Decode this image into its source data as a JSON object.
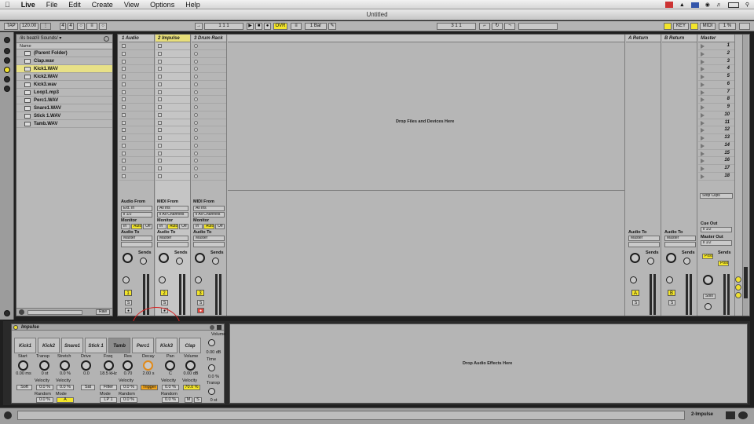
{
  "menubar": {
    "app": "Live",
    "items": [
      "File",
      "Edit",
      "Create",
      "View",
      "Options",
      "Help"
    ]
  },
  "window": {
    "title": "Untitled"
  },
  "transport": {
    "tap": "TAP",
    "tempo": "120.00",
    "signature_num": "4",
    "signature_den": "4",
    "arrangement_position": "1    1    1",
    "ovr": "OVR",
    "quantize": "1 Bar",
    "loop_start": "3    1    1",
    "key": "KEY",
    "midi": "MIDI",
    "cpu": "1 %"
  },
  "browser": {
    "path": "/ils beat/il Sounds/",
    "column_header": "Name",
    "items": [
      {
        "label": "(Parent Folder)",
        "selected": false
      },
      {
        "label": "Clap.wav",
        "selected": false
      },
      {
        "label": "Kick1.WAV",
        "selected": true
      },
      {
        "label": "Kick2.WAV",
        "selected": false
      },
      {
        "label": "Kick3.wav",
        "selected": false
      },
      {
        "label": "Loop1.mp3",
        "selected": false
      },
      {
        "label": "Perc1.WAV",
        "selected": false
      },
      {
        "label": "Snare1.WAV",
        "selected": false
      },
      {
        "label": "Stick 1.WAV",
        "selected": false
      },
      {
        "label": "Tamb.WAV",
        "selected": false
      }
    ],
    "raw_label": "Raw"
  },
  "session": {
    "tracks": [
      {
        "name": "1 Audio",
        "number": "1",
        "selected": false
      },
      {
        "name": "2 Impulse",
        "number": "2",
        "selected": true
      },
      {
        "name": "3 Drum Rack",
        "number": "3",
        "selected": false
      }
    ],
    "returns": [
      {
        "name": "A Return",
        "letter": "A"
      },
      {
        "name": "B Return",
        "letter": "B"
      }
    ],
    "master": {
      "name": "Master",
      "scenes": [
        "1",
        "2",
        "3",
        "4",
        "5",
        "6",
        "7",
        "8",
        "9",
        "10",
        "11",
        "12",
        "13",
        "14",
        "15",
        "16",
        "17",
        "18"
      ],
      "stop_clips": "Stop Clips",
      "cue_out": "Cue Out",
      "cue_out_value": "ii 1/2",
      "master_out": "Master Out",
      "master_out_value": "ii 1/2",
      "solo": "Solo",
      "post": "Post"
    },
    "drop_message": "Drop Files and Devices Here",
    "io": {
      "audio_from": "Audio From",
      "midi_from": "MIDI From",
      "ext_in": "Ext. In",
      "all_ins": "All Ins",
      "half": "ii 1/2",
      "all_channels": "ii All Channels",
      "monitor": "Monitor",
      "in": "In",
      "auto": "Auto",
      "off": "Off",
      "audio_to": "Audio To",
      "master": "Master",
      "sends": "Sends",
      "a": "A",
      "b": "B",
      "s": "S"
    }
  },
  "impulse": {
    "title": "Impulse",
    "pads": [
      "Kick1",
      "Kick2",
      "Snare1",
      "Stick 1",
      "Tamb",
      "Perc1",
      "Kick3",
      "Clap"
    ],
    "selected_pad": "Tamb",
    "volume_label": "Volume",
    "volume_value": "0.00 dB",
    "time_label": "Time",
    "time_value": "0.0 %",
    "transp_label": "Transp",
    "transp_value": "0 st",
    "params": {
      "start": {
        "label": "Start",
        "value": "0.00 ms"
      },
      "transp": {
        "label": "Transp",
        "value": "0 st"
      },
      "stretch": {
        "label": "Stretch",
        "value": "0.0 %"
      },
      "drive": {
        "label": "Drive",
        "value": "0.0"
      },
      "freq": {
        "label": "Freq",
        "value": "18.5 kHz"
      },
      "res": {
        "label": "Res",
        "value": "0.70"
      },
      "decay": {
        "label": "Decay",
        "value": "2.00 s"
      },
      "pan": {
        "label": "Pan",
        "value": "C"
      },
      "volume": {
        "label": "Volume",
        "value": "0.00 dB"
      }
    },
    "row2": {
      "soft": "Soft",
      "velocity": "Velocity",
      "vel_transp": "0.0 %",
      "vel_stretch": "0.0 %",
      "sat": "Sat",
      "filter": "Filter",
      "vel_freq": "0.0 %",
      "trigger": "Trigger",
      "vel_decay": "0.0 %",
      "vel_vol": "70.0 %",
      "random": "Random",
      "mode": "Mode",
      "rnd_transp": "0.0 %",
      "mode_value": "A",
      "lp": "LP 1",
      "rnd_freq": "0.0 %",
      "rnd_pan": "0.0 %",
      "m": "M",
      "s": "S"
    }
  },
  "effects_drop": "Drop Audio Effects Here",
  "status": {
    "track": "2-Impulse"
  }
}
